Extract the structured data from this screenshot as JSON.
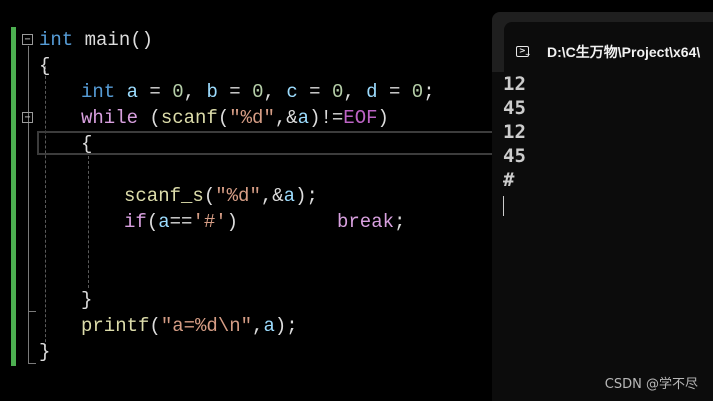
{
  "editor": {
    "lines": {
      "l1": {
        "kw_int": "int",
        "rest": " main()"
      },
      "l2": {
        "text": "{"
      },
      "l3": {
        "kw_int": "int",
        "a": "a",
        "eq1": " = ",
        "n1": "0",
        "sep1": ", ",
        "b": "b",
        "eq2": " = ",
        "n2": "0",
        "sep2": ", ",
        "c": "c",
        "eq3": " = ",
        "n3": "0",
        "sep3": ", ",
        "d": "d",
        "eq4": " = ",
        "n4": "0",
        "end": ";"
      },
      "l4": {
        "kw_while": "while",
        "p1": " (",
        "fn": "scanf",
        "p2": "(",
        "str": "\"%d\"",
        "p3": ",&",
        "a": "a",
        "p4": ")!=",
        "eof": "EOF",
        "p5": ")"
      },
      "l5": {
        "text": "{"
      },
      "l6": {
        "fn": "scanf_s",
        "p1": "(",
        "str": "\"%d\"",
        "p2": ",&",
        "a": "a",
        "p3": ");"
      },
      "l7": {
        "kw_if": "if",
        "p1": "(",
        "a": "a",
        "p2": "==",
        "chr": "'#'",
        "p3": ")",
        "kw_break": "break",
        "p4": ";"
      },
      "l8": {
        "text": "}"
      },
      "l9": {
        "fn": "printf",
        "p1": "(",
        "str": "\"a=%d\\n\"",
        "p2": ",",
        "a": "a",
        "p3": ");"
      },
      "l10": {
        "text": "}"
      }
    },
    "fold_symbol": "−"
  },
  "console": {
    "title": "D:\\C生万物\\Project\\x64\\",
    "output": [
      "12",
      "45",
      "12",
      "45",
      "#"
    ]
  },
  "watermark": "CSDN @学不尽",
  "colors": {
    "keyword": "#569cd6",
    "control": "#d8a0df",
    "string": "#d69d85",
    "variable": "#9cdcfe",
    "number": "#b5cea8",
    "macro": "#bd63c5",
    "function": "#dcdcaa",
    "change_bar": "#4caf50"
  }
}
